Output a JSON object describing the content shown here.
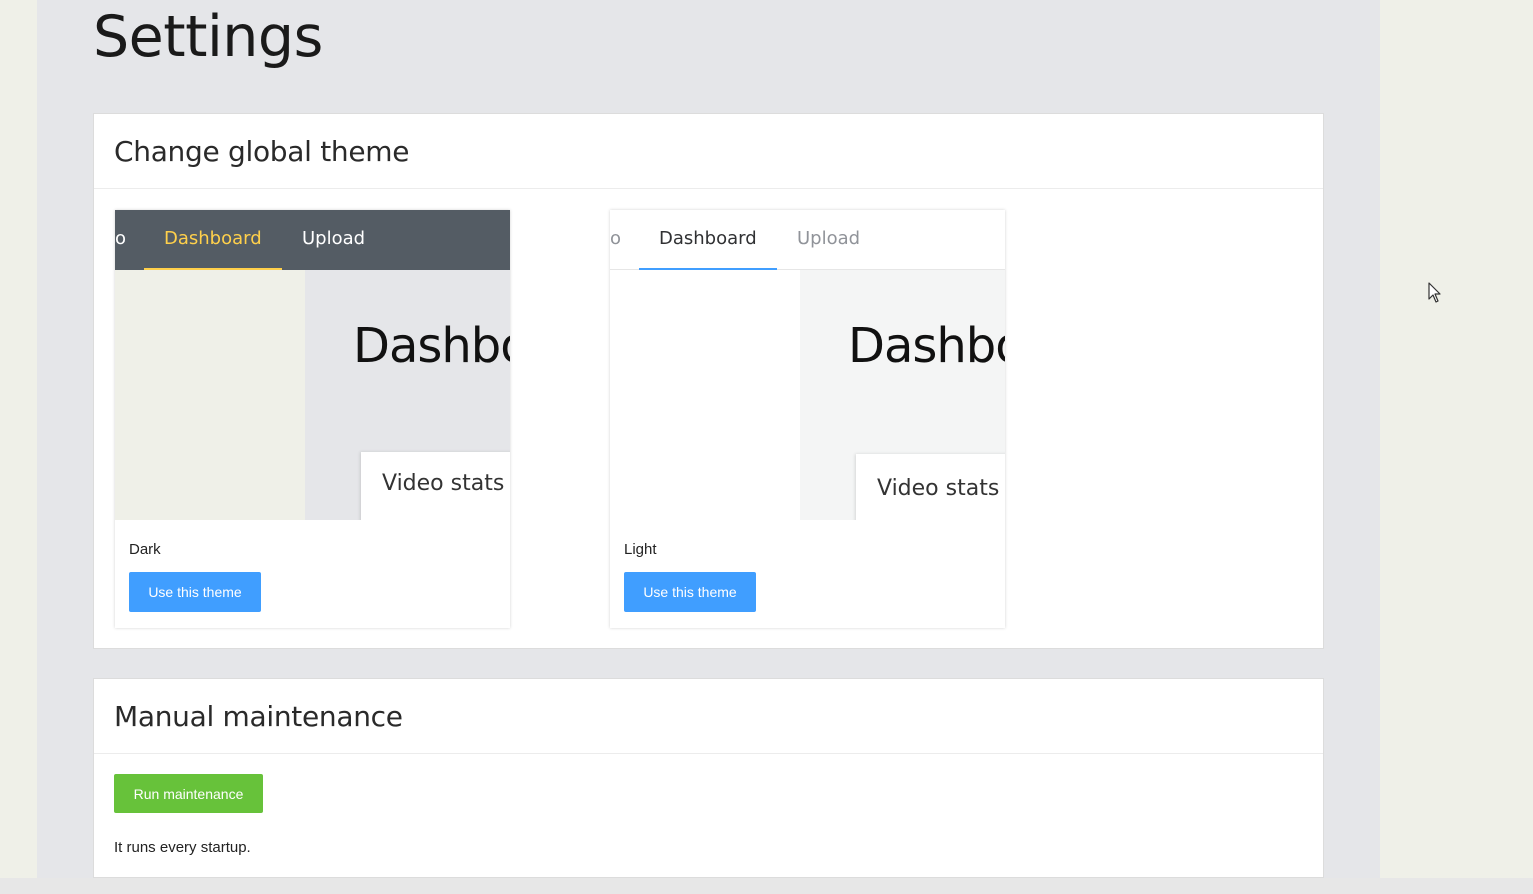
{
  "page": {
    "title": "Settings"
  },
  "theme_section": {
    "title": "Change global theme",
    "themes": [
      {
        "name": "Dark",
        "button_label": "Use this theme",
        "preview": {
          "tab_partial": "o",
          "tab_active": "Dashboard",
          "tab_other": "Upload",
          "heading": "Dashboard",
          "widget_title": "Video stats"
        }
      },
      {
        "name": "Light",
        "button_label": "Use this theme",
        "preview": {
          "tab_partial": "o",
          "tab_active": "Dashboard",
          "tab_other": "Upload",
          "heading": "Dashboard",
          "widget_title": "Video stats"
        }
      }
    ]
  },
  "maintenance_section": {
    "title": "Manual maintenance",
    "button_label": "Run maintenance",
    "note": "It runs every startup."
  },
  "colors": {
    "primary_button": "#409eff",
    "success_button": "#67c23a",
    "dark_nav": "#545c64",
    "dark_active": "#ffd04b",
    "light_active": "#409eff"
  }
}
